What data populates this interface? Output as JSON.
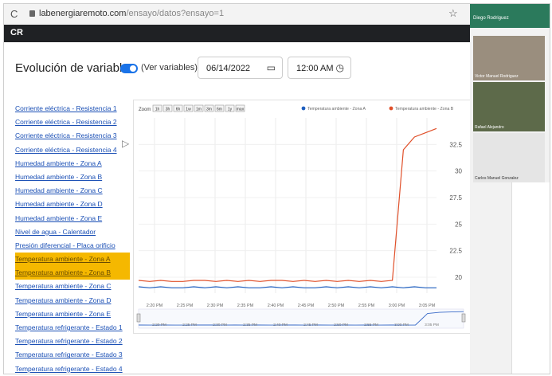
{
  "browser": {
    "reload_icon": "reload-icon",
    "url_host": "labenergiaremoto.com",
    "url_path": "/ensayo/datos?ensayo=1"
  },
  "header": {
    "brand": "CR"
  },
  "page": {
    "title": "Evolución de variables",
    "toggle_label": "(Ver variables)",
    "toggle_on": true,
    "date_value": "06/14/2022",
    "time_value": "12:00 AM"
  },
  "sidebar": {
    "items": [
      {
        "label": "Corriente eléctrica - Resistencia 1",
        "active": false
      },
      {
        "label": "Corriente eléctrica - Resistencia 2",
        "active": false
      },
      {
        "label": "Corriente eléctrica - Resistencia 3",
        "active": false
      },
      {
        "label": "Corriente eléctrica - Resistencia 4",
        "active": false
      },
      {
        "label": "Humedad ambiente - Zona A",
        "active": false
      },
      {
        "label": "Humedad ambiente - Zona B",
        "active": false
      },
      {
        "label": "Humedad ambiente - Zona C",
        "active": false
      },
      {
        "label": "Humedad ambiente - Zona D",
        "active": false
      },
      {
        "label": "Humedad ambiente - Zona E",
        "active": false
      },
      {
        "label": "Nivel de agua - Calentador",
        "active": false
      },
      {
        "label": "Presión diferencial - Placa orificio",
        "active": false
      },
      {
        "label": "Temperatura ambiente - Zona A",
        "active": true
      },
      {
        "label": "Temperatura ambiente - Zona B",
        "active": true
      },
      {
        "label": "Temperatura ambiente - Zona C",
        "active": false
      },
      {
        "label": "Temperatura ambiente - Zona D",
        "active": false
      },
      {
        "label": "Temperatura ambiente - Zona E",
        "active": false
      },
      {
        "label": "Temperatura refrigerante - Estado 1",
        "active": false
      },
      {
        "label": "Temperatura refrigerante - Estado 2",
        "active": false
      },
      {
        "label": "Temperatura refrigerante - Estado 3",
        "active": false
      },
      {
        "label": "Temperatura refrigerante - Estado 4",
        "active": false
      }
    ]
  },
  "chart_data": {
    "type": "line",
    "zoom_label": "Zoom",
    "zoom_buttons": [
      "1h",
      "3h",
      "6h",
      "1w",
      "1m",
      "3m",
      "6m",
      "1y",
      "max"
    ],
    "legend_position": "top-right",
    "series": [
      {
        "name": "Temperatura ambiente - Zona A",
        "color": "#1f5fbf",
        "values": [
          19.1,
          19.0,
          19.1,
          19.0,
          19.0,
          19.1,
          19.0,
          19.1,
          19.0,
          19.1,
          19.0,
          19.0,
          19.1,
          19.0,
          19.1,
          19.0,
          19.0,
          19.1,
          19.0,
          19.1,
          19.0,
          19.1,
          19.0,
          19.1,
          19.0,
          19.1,
          19.0,
          19.0
        ]
      },
      {
        "name": "Temperatura ambiente - Zona B",
        "color": "#e0502a",
        "values": [
          19.7,
          19.6,
          19.7,
          19.6,
          19.6,
          19.7,
          19.7,
          19.6,
          19.7,
          19.6,
          19.7,
          19.6,
          19.7,
          19.7,
          19.6,
          19.7,
          19.6,
          19.7,
          19.6,
          19.7,
          19.6,
          19.7,
          19.6,
          19.7,
          32.0,
          33.2,
          33.6,
          34.0
        ]
      }
    ],
    "x_ticks": [
      "2:20 PM",
      "2:25 PM",
      "2:30 PM",
      "2:35 PM",
      "2:40 PM",
      "2:45 PM",
      "2:50 PM",
      "2:55 PM",
      "3:00 PM",
      "3:05 PM"
    ],
    "navigator_ticks": [
      "2:20 PM",
      "2:25 PM",
      "2:30 PM",
      "2:35 PM",
      "2:40 PM",
      "2:45 PM",
      "2:50 PM",
      "2:55 PM",
      "3:00 PM",
      "3:05 PM"
    ],
    "y_ticks": [
      20,
      22.5,
      25,
      27.5,
      30,
      32.5
    ],
    "ylim": [
      18.5,
      35
    ],
    "grid": true
  },
  "video_panel": {
    "host_name": "Diego Rodriguez",
    "participants": [
      {
        "name": "Victor Manuel Rodriguez"
      },
      {
        "name": "Rafael Alejandro"
      },
      {
        "name": "Carlos Manuel Gonzalez"
      }
    ]
  }
}
